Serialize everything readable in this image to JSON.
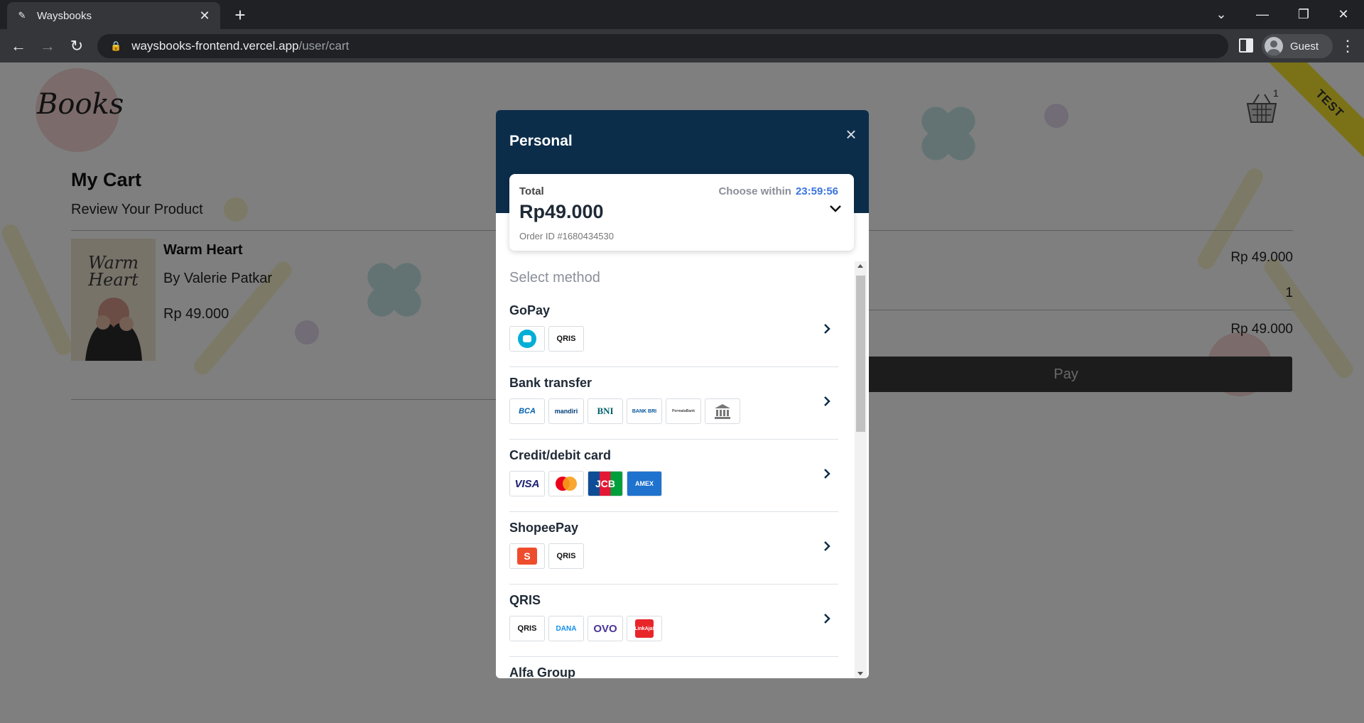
{
  "browser": {
    "tab_title": "Waysbooks",
    "url_host": "waysbooks-frontend.vercel.app",
    "url_path": "/user/cart",
    "profile_name": "Guest",
    "new_tab_glyph": "+",
    "tab_close_glyph": "✕",
    "window_controls": {
      "minimize": "—",
      "restore": "❐",
      "close": "✕",
      "tab_search": "⌄"
    }
  },
  "site": {
    "logo_text": "Books",
    "cart_count": "1",
    "test_ribbon": "TEST"
  },
  "cart": {
    "title": "My Cart",
    "subtitle": "Review Your Product",
    "item": {
      "title": "Warm Heart",
      "author": "By Valerie Patkar",
      "price": "Rp 49.000",
      "cover_title": "Warm Heart"
    },
    "summary": {
      "subtotal": "Rp 49.000",
      "qty": "1",
      "total": "Rp 49.000"
    },
    "pay_label": "Pay"
  },
  "modal": {
    "title": "Personal",
    "close_glyph": "×",
    "total_label": "Total",
    "choose_within": "Choose within",
    "timer": "23:59:56",
    "amount": "Rp49.000",
    "order_id": "Order ID #1680434530",
    "select_method": "Select method",
    "methods": [
      {
        "name": "GoPay",
        "logos": [
          "gopay",
          "QRIS"
        ]
      },
      {
        "name": "Bank transfer",
        "logos": [
          "BCA",
          "mandiri",
          "BNI",
          "BANK BRI",
          "PermataBank",
          "bank"
        ]
      },
      {
        "name": "Credit/debit card",
        "logos": [
          "VISA",
          "mastercard",
          "JCB",
          "AMEX"
        ]
      },
      {
        "name": "ShopeePay",
        "logos": [
          "S",
          "QRIS"
        ]
      },
      {
        "name": "QRIS",
        "logos": [
          "QRIS",
          "DANA",
          "OVO",
          "LinkAja!"
        ]
      },
      {
        "name": "Alfa Group",
        "logos": []
      }
    ]
  },
  "colors": {
    "modal_header": "#0c2d4a",
    "timer": "#3b74e0",
    "pay_button": "#393939",
    "ribbon": "#f6e531"
  }
}
